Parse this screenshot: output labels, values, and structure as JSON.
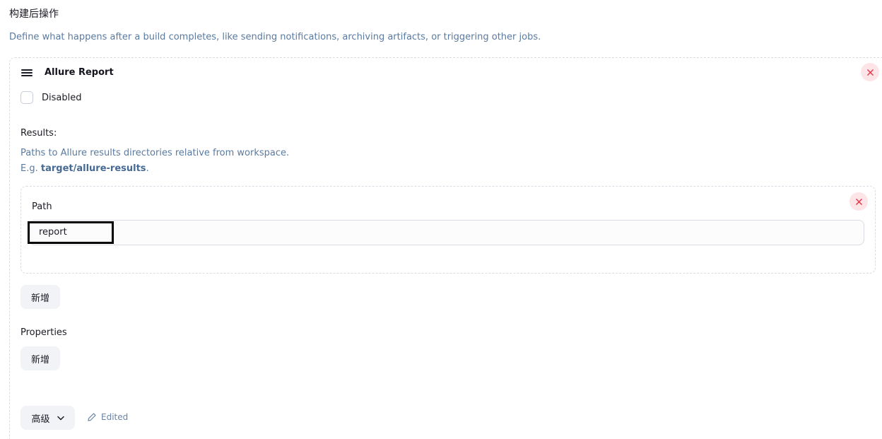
{
  "section": {
    "title": "构建后操作",
    "description": "Define what happens after a build completes, like sending notifications, archiving artifacts, or triggering other jobs."
  },
  "step": {
    "title": "Allure Report",
    "disabled_label": "Disabled",
    "disabled_checked": false,
    "results_label": "Results:",
    "results_help_line1": "Paths to Allure results directories relative from workspace.",
    "results_help_prefix": "E.g. ",
    "results_help_example": "target/allure-results",
    "results_help_suffix": ".",
    "path": {
      "label": "Path",
      "value": "report"
    },
    "add_results_label": "新增",
    "properties_label": "Properties",
    "add_properties_label": "新增",
    "advanced_label": "高级",
    "edited_label": "Edited"
  },
  "icons": {
    "drag": "drag-handle-icon",
    "close": "close-icon",
    "chevron": "chevron-down-icon",
    "edit": "pencil-icon"
  },
  "colors": {
    "help_text": "#5a7aa0",
    "close_bg": "#fde4e6",
    "close_x": "#e0384a",
    "button_bg": "#f1f3f7"
  }
}
